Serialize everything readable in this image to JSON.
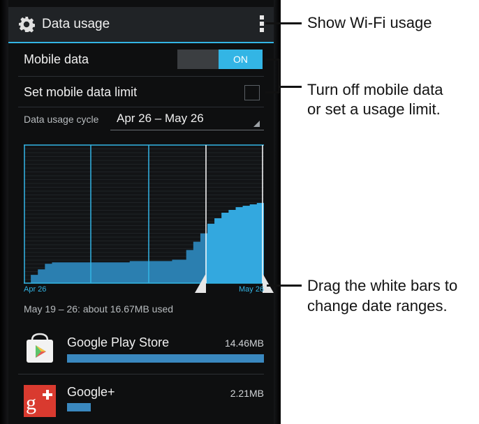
{
  "action_bar": {
    "title": "Data usage",
    "settings_icon": "gear-icon",
    "overflow_icon": "overflow-menu-icon"
  },
  "mobile_data": {
    "label": "Mobile data",
    "switch_state": "ON"
  },
  "data_limit": {
    "label": "Set mobile data limit",
    "checked": false
  },
  "cycle": {
    "label": "Data usage cycle",
    "value": "Apr 26 – May 26"
  },
  "chart_data": {
    "type": "area",
    "title": "",
    "xlabel": "",
    "ylabel": "",
    "start_label": "Apr 26",
    "end_label": "May 26",
    "selection": [
      "May 19",
      "May 26"
    ],
    "cumulative_usage_fraction": [
      0.0,
      0.06,
      0.1,
      0.14,
      0.15,
      0.15,
      0.15,
      0.15,
      0.15,
      0.15,
      0.15,
      0.15,
      0.15,
      0.15,
      0.15,
      0.16,
      0.16,
      0.16,
      0.16,
      0.16,
      0.16,
      0.17,
      0.17,
      0.24,
      0.3,
      0.36,
      0.43,
      0.47,
      0.51,
      0.53,
      0.55,
      0.56,
      0.57,
      0.58
    ],
    "accent_color": "#33b5e5"
  },
  "usage_summary": "May 19 – 26: about 16.67MB used",
  "apps": [
    {
      "name": "Google Play Store",
      "size": "14.46MB",
      "fraction": 1.0,
      "icon": "play-store-icon"
    },
    {
      "name": "Google+",
      "size": "2.21MB",
      "fraction": 0.12,
      "icon": "google-plus-icon"
    }
  ],
  "callouts": {
    "wifi": "Show Wi-Fi usage",
    "mobile_line1": "Turn off mobile data",
    "mobile_line2": "or set a usage limit.",
    "drag_line1": "Drag the white bars to",
    "drag_line2": "change date ranges."
  }
}
